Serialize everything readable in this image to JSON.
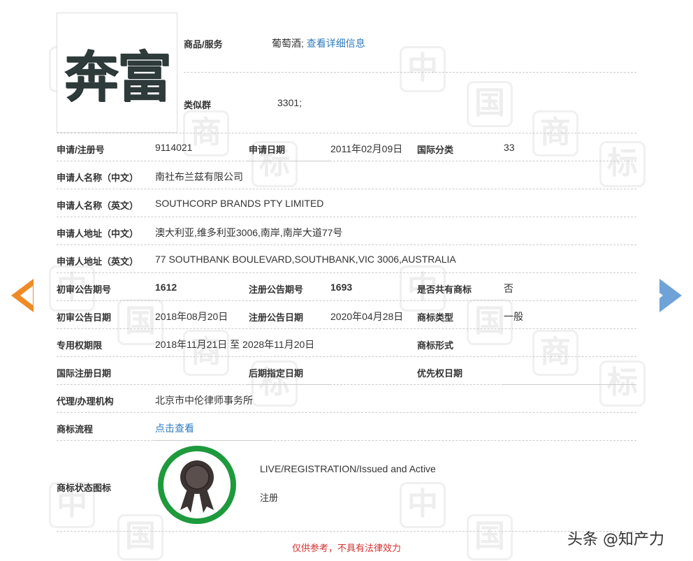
{
  "trademark": {
    "mark_text": "奔富"
  },
  "goods": {
    "label": "商品/服务",
    "value": "葡萄酒;",
    "detail_link": "查看详细信息"
  },
  "similar_group": {
    "label": "类似群",
    "value": "3301;"
  },
  "rows": {
    "reg_no": {
      "label": "申请/注册号",
      "value": "9114021"
    },
    "apply_date": {
      "label": "申请日期",
      "value": "2011年02月09日"
    },
    "intl_class": {
      "label": "国际分类",
      "value": "33"
    },
    "applicant_cn": {
      "label": "申请人名称（中文）",
      "value": "南社布兰兹有限公司"
    },
    "applicant_en": {
      "label": "申请人名称（英文）",
      "value": "SOUTHCORP BRANDS PTY LIMITED"
    },
    "address_cn": {
      "label": "申请人地址（中文）",
      "value": "澳大利亚,维多利亚3006,南岸,南岸大道77号"
    },
    "address_en": {
      "label": "申请人地址（英文）",
      "value": "77 SOUTHBANK BOULEVARD,SOUTHBANK,VIC 3006,AUSTRALIA"
    },
    "prelim_no": {
      "label": "初审公告期号",
      "value": "1612"
    },
    "reg_pub_no": {
      "label": "注册公告期号",
      "value": "1693"
    },
    "shared": {
      "label": "是否共有商标",
      "value": "否"
    },
    "prelim_date": {
      "label": "初审公告日期",
      "value": "2018年08月20日"
    },
    "reg_pub_date": {
      "label": "注册公告日期",
      "value": "2020年04月28日"
    },
    "tm_type": {
      "label": "商标类型",
      "value": "一般"
    },
    "exclusive_period": {
      "label": "专用权期限",
      "value": "2018年11月21日 至 2028年11月20日"
    },
    "tm_form": {
      "label": "商标形式",
      "value": ""
    },
    "intl_reg_date": {
      "label": "国际注册日期",
      "value": ""
    },
    "later_date": {
      "label": "后期指定日期",
      "value": ""
    },
    "priority_date": {
      "label": "优先权日期",
      "value": ""
    },
    "agent": {
      "label": "代理/办理机构",
      "value": "北京市中伦律师事务所"
    },
    "flow": {
      "label": "商标流程",
      "value": "点击查看"
    },
    "status_icon": {
      "label": "商标状态图标"
    }
  },
  "status": {
    "english": "LIVE/REGISTRATION/Issued and Active",
    "chinese": "注册"
  },
  "footnote": "仅供参考，不具有法律效力",
  "watermark_chars": [
    "中",
    "国",
    "商",
    "标"
  ],
  "brand": "头条 @知产力",
  "colors": {
    "link": "#2f7bbd",
    "arrow_left": "#f08a24",
    "arrow_right": "#6fa3d8",
    "badge_ring": "#1e9a3c",
    "footnote": "#d32f2f"
  }
}
